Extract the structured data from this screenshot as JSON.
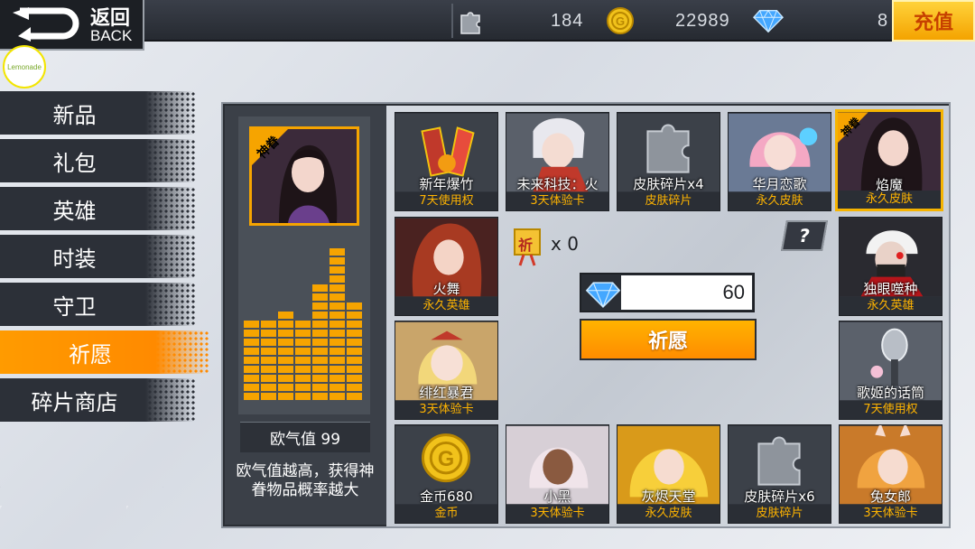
{
  "topbar": {
    "back_cn": "返回",
    "back_en": "BACK",
    "fragments": "184",
    "gold": "22989",
    "diamonds": "8",
    "recharge": "充值"
  },
  "logo": "Lemonade",
  "menu": {
    "items": [
      {
        "label": "新品"
      },
      {
        "label": "礼包"
      },
      {
        "label": "英雄"
      },
      {
        "label": "时装"
      },
      {
        "label": "守卫"
      },
      {
        "label": "祈愿"
      },
      {
        "label": "碎片商店"
      }
    ],
    "active_index": 5
  },
  "luck": {
    "label": "欧气值 99",
    "description": "欧气值越高，获得神眷物品概率越大",
    "level": 0.75
  },
  "featured": {
    "badge": "神眷"
  },
  "items": [
    {
      "name": "新年爆竹",
      "tag": "7天使用权"
    },
    {
      "name": "未来科技：火",
      "tag": "3天体验卡"
    },
    {
      "name": "皮肤碎片x4",
      "tag": "皮肤碎片"
    },
    {
      "name": "华月恋歌",
      "tag": "永久皮肤"
    },
    {
      "name": "焰魔",
      "tag": "永久皮肤",
      "badge": "神眷"
    },
    {
      "name": "火舞",
      "tag": "永久英雄"
    },
    {
      "name": "独眼噬种",
      "tag": "永久英雄"
    },
    {
      "name": "绯红暴君",
      "tag": "3天体验卡"
    },
    {
      "name": "歌姬的话筒",
      "tag": "7天使用权"
    },
    {
      "name": "金币680",
      "tag": "金币"
    },
    {
      "name": "小黑",
      "tag": "3天体验卡"
    },
    {
      "name": "灰烬天堂",
      "tag": "永久皮肤"
    },
    {
      "name": "皮肤碎片x6",
      "tag": "皮肤碎片"
    },
    {
      "name": "兔女郎",
      "tag": "3天体验卡"
    }
  ],
  "wish": {
    "ticket_badge": "祈",
    "ticket_count": "x 0",
    "cost": "60",
    "button": "祈愿",
    "help": "?"
  },
  "colors": {
    "accent": "#ff8a00",
    "tag": "#ffb400",
    "panel": "#3b4048"
  }
}
